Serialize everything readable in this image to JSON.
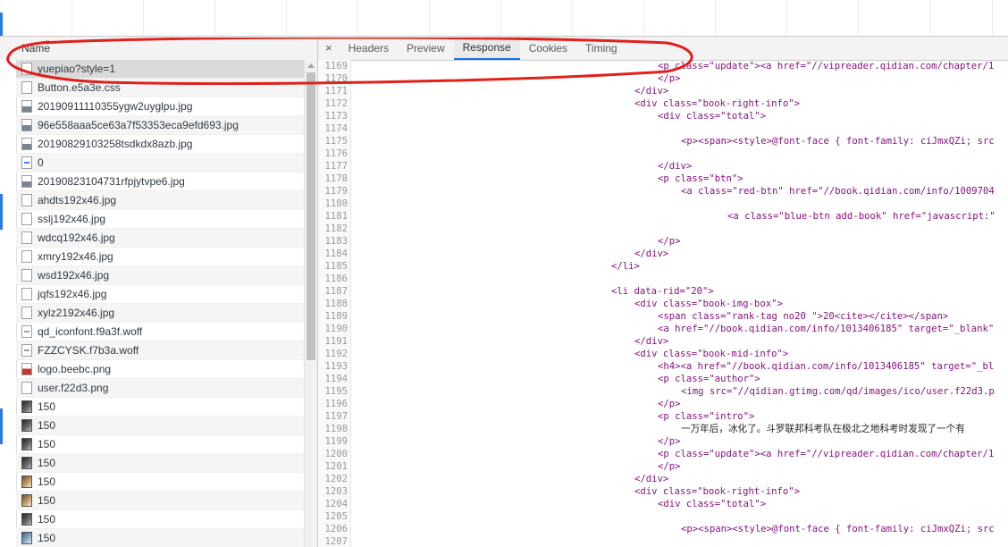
{
  "devtools": {
    "name_column_header": "Name",
    "tabs": [
      {
        "label": "Headers",
        "active": false
      },
      {
        "label": "Preview",
        "active": false
      },
      {
        "label": "Response",
        "active": true
      },
      {
        "label": "Cookies",
        "active": false
      },
      {
        "label": "Timing",
        "active": false
      }
    ],
    "close_glyph": "×",
    "accent_color": "#1a73e8",
    "annotation_color": "#e0201b"
  },
  "network_list": [
    {
      "name": "yuepiao?style=1",
      "icon": "document-icon",
      "selected": true
    },
    {
      "name": "Button.e5a3e.css",
      "icon": "document-icon"
    },
    {
      "name": "20190911110355ygw2uyglpu.jpg",
      "icon": "image-icon"
    },
    {
      "name": "96e558aaa5ce63a7f53353eca9efd693.jpg",
      "icon": "image-icon"
    },
    {
      "name": "20190829103258tsdkdx8azb.jpg",
      "icon": "image-icon"
    },
    {
      "name": "0",
      "icon": "document-blue-icon"
    },
    {
      "name": "20190823104731rfpjytvpe6.jpg",
      "icon": "image-icon"
    },
    {
      "name": "ahdts192x46.jpg",
      "icon": "document-icon"
    },
    {
      "name": "sslj192x46.jpg",
      "icon": "document-icon"
    },
    {
      "name": "wdcq192x46.jpg",
      "icon": "document-icon"
    },
    {
      "name": "xmry192x46.jpg",
      "icon": "document-icon"
    },
    {
      "name": "wsd192x46.jpg",
      "icon": "document-icon"
    },
    {
      "name": "jqfs192x46.jpg",
      "icon": "document-icon"
    },
    {
      "name": "xylz2192x46.jpg",
      "icon": "document-icon"
    },
    {
      "name": "qd_iconfont.f9a3f.woff",
      "icon": "font-icon"
    },
    {
      "name": "FZZCYSK.f7b3a.woff",
      "icon": "font-icon"
    },
    {
      "name": "logo.beebc.png",
      "icon": "image-red-icon"
    },
    {
      "name": "user.f22d3.png",
      "icon": "document-icon"
    },
    {
      "name": "150",
      "icon": "thumbnail-icon"
    },
    {
      "name": "150",
      "icon": "thumbnail-icon"
    },
    {
      "name": "150",
      "icon": "thumbnail-icon"
    },
    {
      "name": "150",
      "icon": "thumbnail-icon"
    },
    {
      "name": "150",
      "icon": "thumbnail-brown-icon"
    },
    {
      "name": "150",
      "icon": "thumbnail-brown-icon"
    },
    {
      "name": "150",
      "icon": "thumbnail-icon"
    },
    {
      "name": "150",
      "icon": "thumbnail-blue-icon"
    }
  ],
  "response_lines": [
    {
      "n": "1169",
      "indent": 12,
      "code": "<p class=\"update\"><a href=\"//vipreader.qidian.com/chapter/1"
    },
    {
      "n": "1170",
      "indent": 12,
      "code": "</p>"
    },
    {
      "n": "1171",
      "indent": 8,
      "code": "</div>"
    },
    {
      "n": "1172",
      "indent": 8,
      "code": "<div class=\"book-right-info\">"
    },
    {
      "n": "1173",
      "indent": 12,
      "code": "<div class=\"total\">"
    },
    {
      "n": "1174",
      "indent": 0,
      "code": ""
    },
    {
      "n": "1175",
      "indent": 16,
      "code": "<p><span><style>@font-face { font-family: ciJmxQZi; src"
    },
    {
      "n": "1176",
      "indent": 0,
      "code": ""
    },
    {
      "n": "1177",
      "indent": 12,
      "code": "</div>"
    },
    {
      "n": "1178",
      "indent": 12,
      "code": "<p class=\"btn\">"
    },
    {
      "n": "1179",
      "indent": 16,
      "code": "<a class=\"red-btn\" href=\"//book.qidian.com/info/1009704"
    },
    {
      "n": "1180",
      "indent": 0,
      "code": ""
    },
    {
      "n": "1181",
      "indent": 24,
      "code": "<a class=\"blue-btn add-book\" href=\"javascript:\""
    },
    {
      "n": "1182",
      "indent": 0,
      "code": ""
    },
    {
      "n": "1183",
      "indent": 12,
      "code": "</p>"
    },
    {
      "n": "1184",
      "indent": 8,
      "code": "</div>"
    },
    {
      "n": "1185",
      "indent": 4,
      "code": "</li>"
    },
    {
      "n": "1186",
      "indent": 0,
      "code": ""
    },
    {
      "n": "1187",
      "indent": 4,
      "code": "<li data-rid=\"20\">"
    },
    {
      "n": "1188",
      "indent": 8,
      "code": "<div class=\"book-img-box\">"
    },
    {
      "n": "1189",
      "indent": 12,
      "code": "<span class=\"rank-tag no20 \">20<cite></cite></span>"
    },
    {
      "n": "1190",
      "indent": 12,
      "code": "<a href=\"//book.qidian.com/info/1013406185\" target=\"_blank\""
    },
    {
      "n": "1191",
      "indent": 8,
      "code": "</div>"
    },
    {
      "n": "1192",
      "indent": 8,
      "code": "<div class=\"book-mid-info\">"
    },
    {
      "n": "1193",
      "indent": 12,
      "code": "<h4><a href=\"//book.qidian.com/info/1013406185\" target=\"_bl"
    },
    {
      "n": "1194",
      "indent": 12,
      "code": "<p class=\"author\">"
    },
    {
      "n": "1195",
      "indent": 16,
      "code": "<img src=\"//qidian.gtimg.com/qd/images/ico/user.f22d3.p"
    },
    {
      "n": "1196",
      "indent": 12,
      "code": "</p>"
    },
    {
      "n": "1197",
      "indent": 12,
      "code": "<p class=\"intro\">"
    },
    {
      "n": "1198",
      "indent": 16,
      "code": "一万年后，冰化了。斗罗联邦科考队在极北之地科考时发现了一个有"
    },
    {
      "n": "1199",
      "indent": 12,
      "code": "</p>"
    },
    {
      "n": "1200",
      "indent": 12,
      "code": "<p class=\"update\"><a href=\"//vipreader.qidian.com/chapter/1"
    },
    {
      "n": "1201",
      "indent": 12,
      "code": "</p>"
    },
    {
      "n": "1202",
      "indent": 8,
      "code": "</div>"
    },
    {
      "n": "1203",
      "indent": 8,
      "code": "<div class=\"book-right-info\">"
    },
    {
      "n": "1204",
      "indent": 12,
      "code": "<div class=\"total\">"
    },
    {
      "n": "1205",
      "indent": 0,
      "code": ""
    },
    {
      "n": "1206",
      "indent": 16,
      "code": "<p><span><style>@font-face { font-family: ciJmxQZi; src"
    },
    {
      "n": "1207",
      "indent": 0,
      "code": ""
    }
  ]
}
